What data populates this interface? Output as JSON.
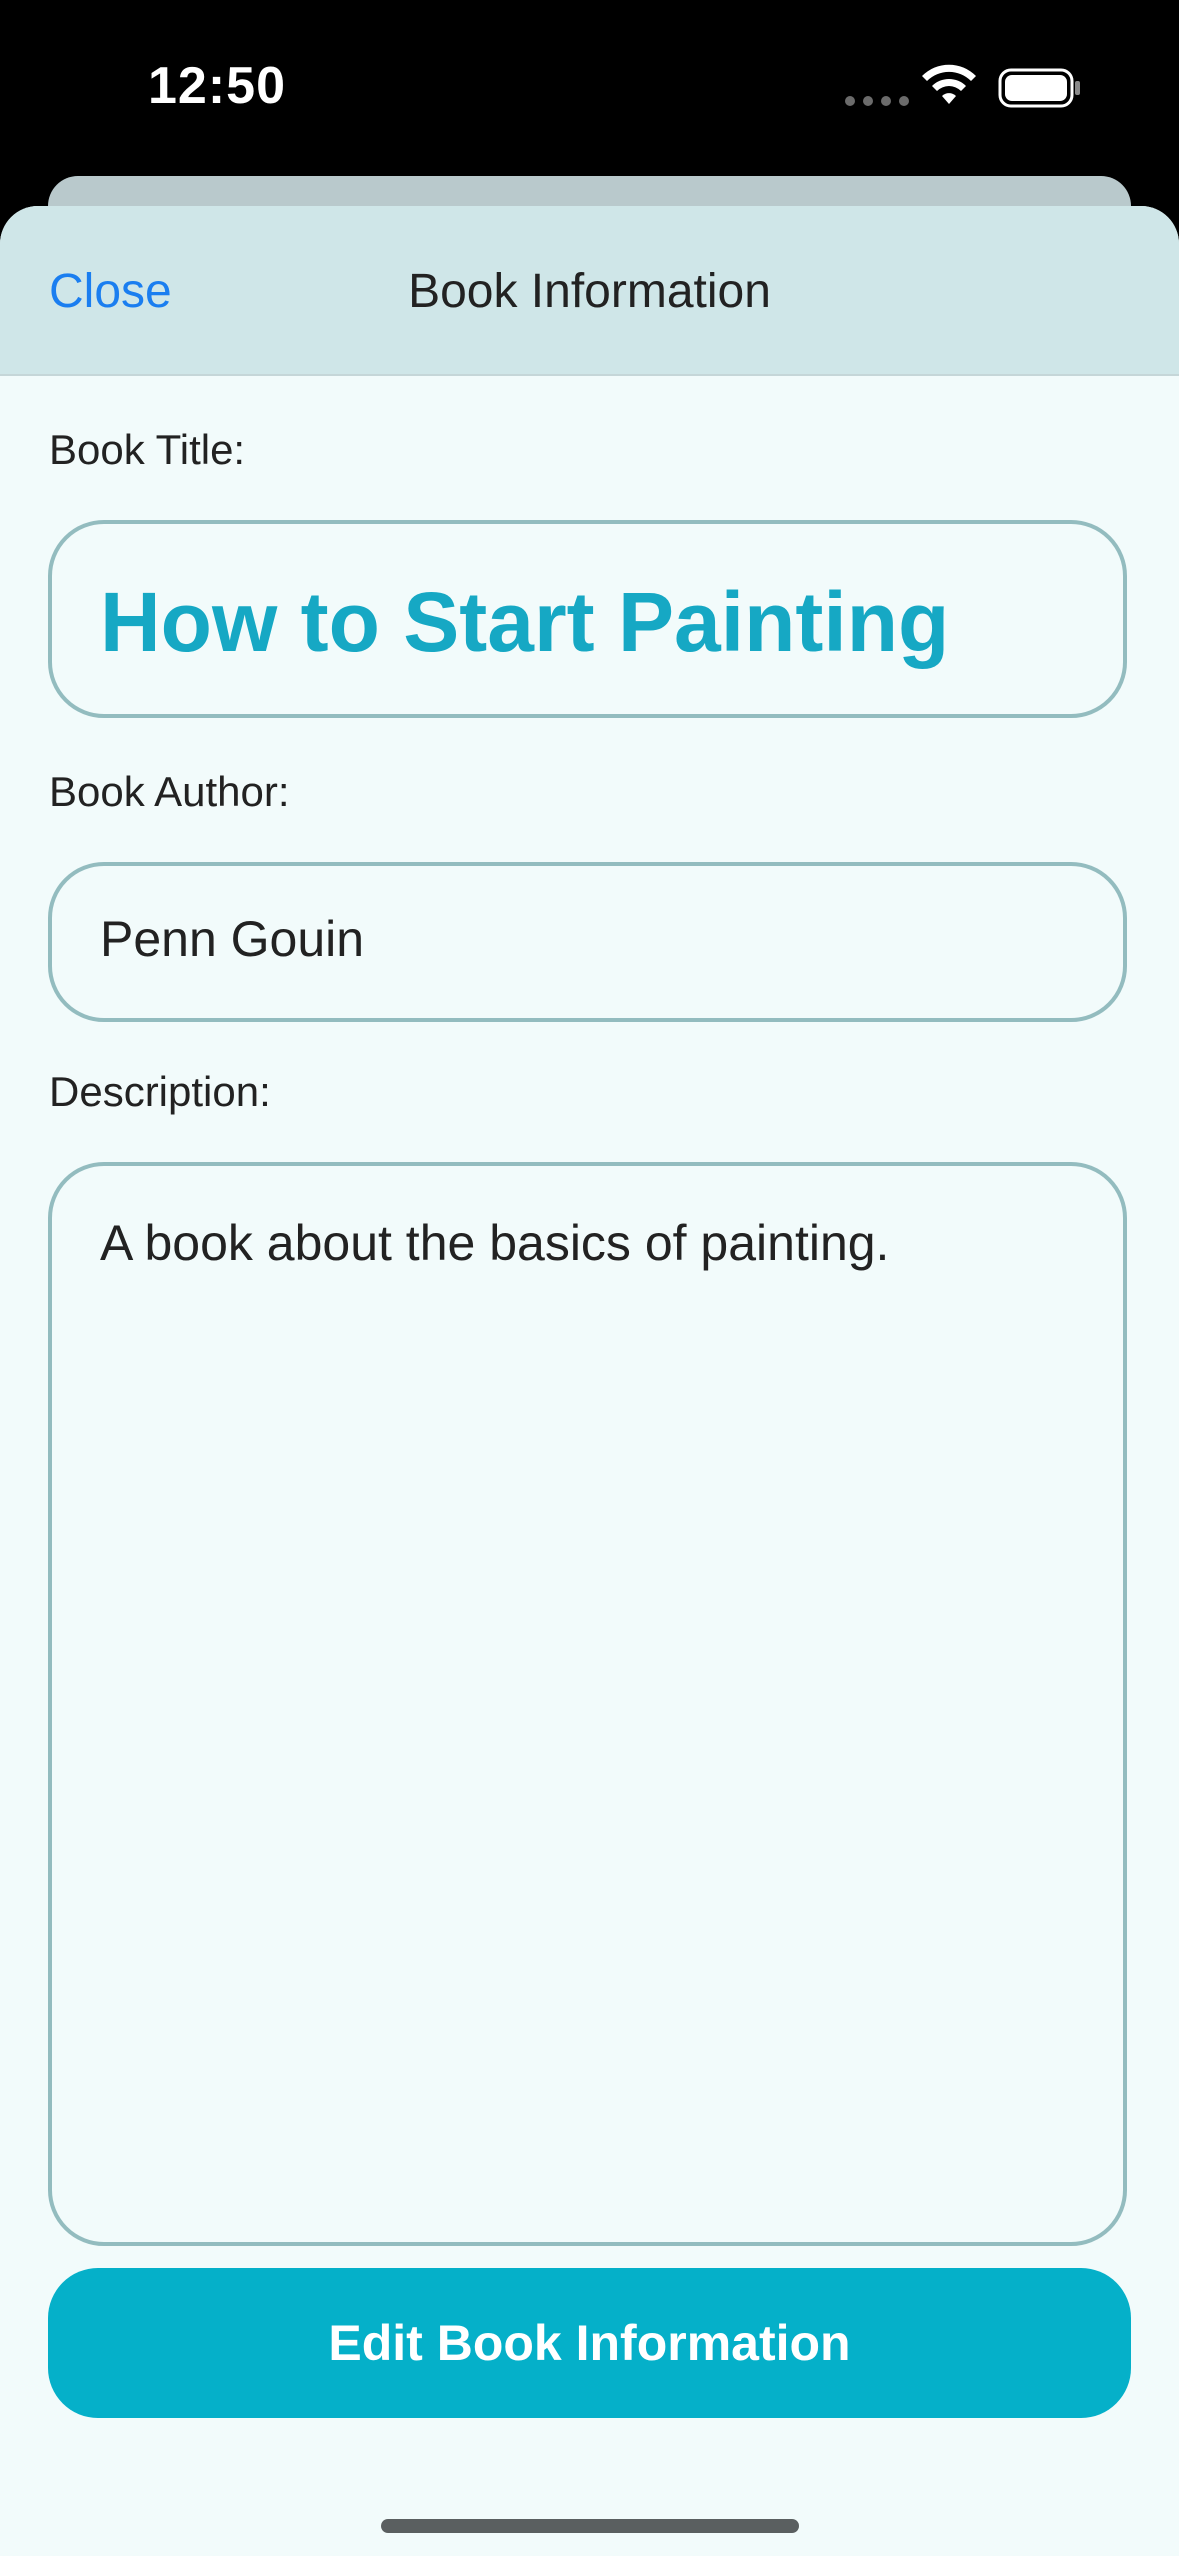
{
  "status_bar": {
    "time": "12:50",
    "icons": [
      "cellular-dots-icon",
      "wifi-icon",
      "battery-icon"
    ]
  },
  "nav": {
    "close_label": "Close",
    "title": "Book Information"
  },
  "form": {
    "title_label": "Book Title:",
    "title_value": "How to Start Painting",
    "author_label": "Book Author:",
    "author_value": "Penn Gouin",
    "description_label": "Description:",
    "description_value": "A book about the basics of painting."
  },
  "actions": {
    "edit_label": "Edit Book Information"
  },
  "colors": {
    "accent": "#05b0c9",
    "title_text": "#16a8c4",
    "link": "#1a7ef0",
    "nav_background": "#cfe6e8",
    "sheet_background": "#f2fbfb",
    "field_border": "#93bcbf"
  }
}
